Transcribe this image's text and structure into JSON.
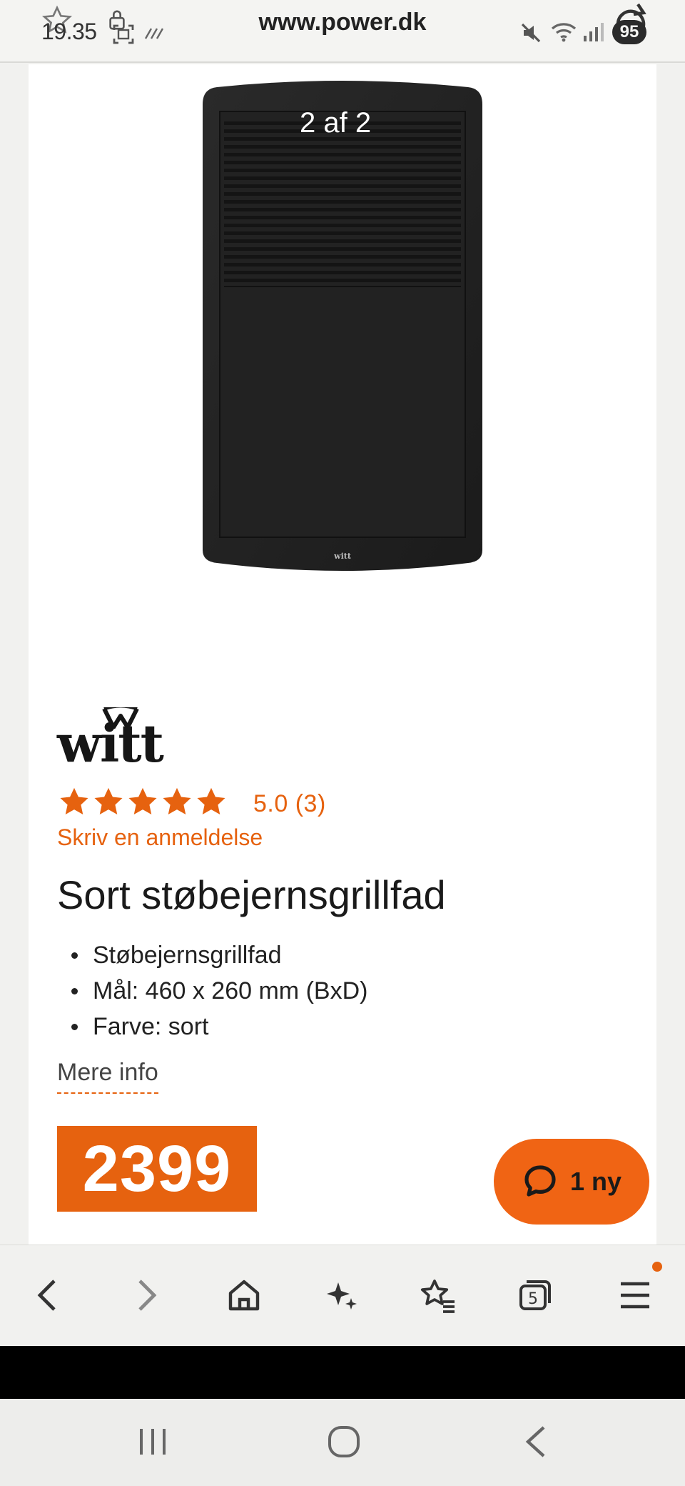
{
  "status_bar": {
    "time": "19.35",
    "url": "www.power.dk",
    "battery": "95",
    "icons": [
      "star-outline-icon",
      "lock-icon",
      "screenshot-icon",
      "mute-icon",
      "wifi-icon",
      "signal-icon",
      "refresh-icon"
    ]
  },
  "product": {
    "image_counter": "2 af 2",
    "image_logo_text": "witt",
    "brand": "witt",
    "rating_value": 5,
    "rating_max": 5,
    "rating_text": "5.0  (3)",
    "review_link": "Skriv en anmeldelse",
    "title": "Sort støbejernsgrillfad",
    "features": [
      "Støbejernsgrillfad",
      "Mål: 460 x 260 mm (BxD)",
      "Farve: sort"
    ],
    "more_info": "Mere info",
    "price": "2399"
  },
  "chat": {
    "label": "1 ny",
    "icon": "chat-bubble-icon"
  },
  "browser_toolbar": {
    "items": [
      "back-icon",
      "forward-icon",
      "home-icon",
      "sparkle-icon",
      "favorites-icon",
      "tabs-icon",
      "menu-icon"
    ],
    "tab_count": "5"
  },
  "colors": {
    "accent": "#e6620f",
    "background": "#f1f1ef",
    "card": "#ffffff"
  }
}
